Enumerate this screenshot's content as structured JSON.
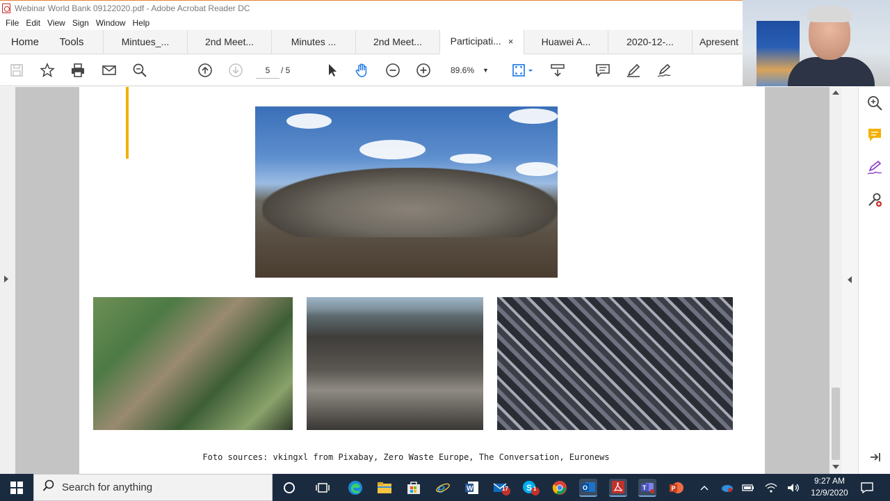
{
  "window": {
    "title": "Webinar World Bank 09122020.pdf - Adobe Acrobat Reader DC"
  },
  "menu": [
    "File",
    "Edit",
    "View",
    "Sign",
    "Window",
    "Help"
  ],
  "nav_tabs": {
    "home": "Home",
    "tools": "Tools"
  },
  "doc_tabs": [
    "Mintues_...",
    "2nd Meet...",
    "Minutes ...",
    "2nd Meet...",
    "Participati...",
    "Huawei A...",
    "2020-12-...",
    "Apresent"
  ],
  "active_tab_close": "×",
  "toolbar": {
    "page_current": "5",
    "page_total": "/ 5",
    "zoom": "89.6%"
  },
  "document": {
    "caption": "Foto sources: vkingxl from Pixabay, Zero Waste Europe, The Conversation, Euronews"
  },
  "taskbar": {
    "search_placeholder": "Search for anything",
    "time": "9:27 AM",
    "date": "12/9/2020",
    "badges": {
      "mail": "17",
      "chrome_ext": "1"
    }
  },
  "colors": {
    "accent_bar": "#f2b100",
    "taskbar_bg": "#1b2b3f",
    "acrobat_red": "#c4302b"
  },
  "icons": {
    "toolbar": [
      "save-icon",
      "bookmark-star-icon",
      "print-icon",
      "email-icon",
      "search-zoom-icon",
      "page-up-icon",
      "page-down-icon",
      "select-pointer-icon",
      "hand-tool-icon",
      "zoom-out-icon",
      "zoom-in-icon",
      "fit-page-icon",
      "scroll-mode-icon",
      "comment-icon",
      "highlight-pen-icon",
      "sign-icon"
    ],
    "right_pane": [
      "search-zoom-icon",
      "comment-icon",
      "fill-sign-icon",
      "more-tools-icon",
      "collapse-pane-icon"
    ]
  }
}
